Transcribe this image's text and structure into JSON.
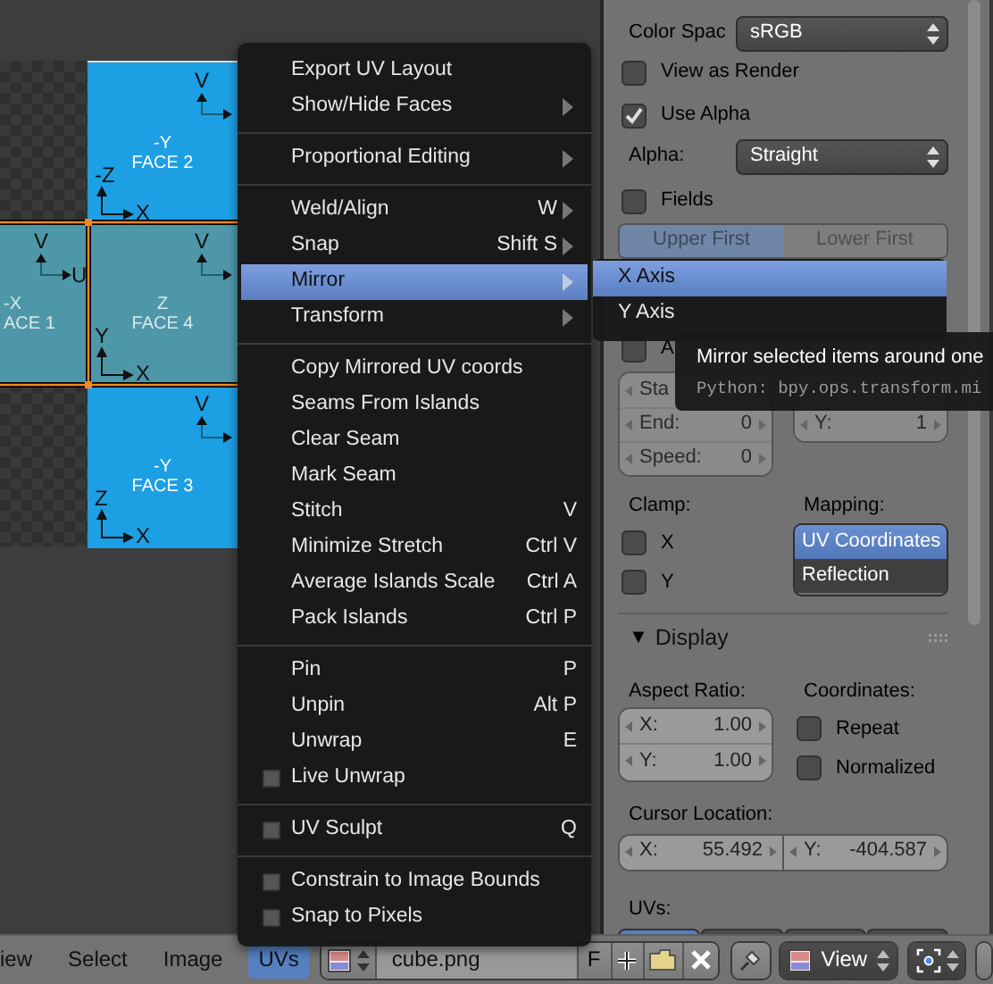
{
  "uv_editor": {
    "faces": [
      {
        "line1": "-Y",
        "line2": "FACE 2",
        "selected": false,
        "top_axis": [
          "V"
        ],
        "bottom_axis": [
          "-Z",
          "X"
        ]
      },
      {
        "line1": "-X",
        "line2": "ACE 1",
        "selected": true,
        "top_axis": [
          "V",
          "U"
        ]
      },
      {
        "line1": "Z",
        "line2": "FACE 4",
        "selected": true,
        "top_axis": [
          "V"
        ],
        "bottom_axis": [
          "Y",
          "X"
        ]
      },
      {
        "line1": "-Y",
        "line2": "FACE 3",
        "selected": false,
        "top_axis": [
          "V"
        ],
        "bottom_axis": [
          "Z",
          "X"
        ]
      }
    ]
  },
  "uvs_menu": {
    "items": [
      {
        "kind": "item",
        "label": "Export UV Layout",
        "submenu": false,
        "highlighted": false
      },
      {
        "kind": "item",
        "label": "Show/Hide Faces",
        "submenu": true,
        "highlighted": false
      },
      {
        "kind": "separator"
      },
      {
        "kind": "item",
        "label": "Proportional Editing",
        "submenu": true,
        "highlighted": false
      },
      {
        "kind": "separator"
      },
      {
        "kind": "item",
        "label": "Weld/Align",
        "shortcut": "W",
        "submenu": true,
        "highlighted": false
      },
      {
        "kind": "item",
        "label": "Snap",
        "shortcut": "Shift S",
        "submenu": true,
        "highlighted": false
      },
      {
        "kind": "item",
        "label": "Mirror",
        "submenu": true,
        "highlighted": true
      },
      {
        "kind": "item",
        "label": "Transform",
        "submenu": true,
        "highlighted": false
      },
      {
        "kind": "separator"
      },
      {
        "kind": "item",
        "label": "Copy Mirrored UV coords",
        "submenu": false,
        "highlighted": false
      },
      {
        "kind": "item",
        "label": "Seams From Islands",
        "submenu": false,
        "highlighted": false
      },
      {
        "kind": "item",
        "label": "Clear Seam",
        "submenu": false,
        "highlighted": false
      },
      {
        "kind": "item",
        "label": "Mark Seam",
        "submenu": false,
        "highlighted": false
      },
      {
        "kind": "item",
        "label": "Stitch",
        "shortcut": "V",
        "submenu": false,
        "highlighted": false
      },
      {
        "kind": "item",
        "label": "Minimize Stretch",
        "shortcut": "Ctrl V",
        "submenu": false,
        "highlighted": false
      },
      {
        "kind": "item",
        "label": "Average Islands Scale",
        "shortcut": "Ctrl A",
        "submenu": false,
        "highlighted": false
      },
      {
        "kind": "item",
        "label": "Pack Islands",
        "shortcut": "Ctrl P",
        "submenu": false,
        "highlighted": false
      },
      {
        "kind": "separator"
      },
      {
        "kind": "item",
        "label": "Pin",
        "shortcut": "P",
        "submenu": false,
        "highlighted": false
      },
      {
        "kind": "item",
        "label": "Unpin",
        "shortcut": "Alt P",
        "submenu": false,
        "highlighted": false
      },
      {
        "kind": "item",
        "label": "Unwrap",
        "shortcut": "E",
        "submenu": false,
        "highlighted": false
      },
      {
        "kind": "toggle",
        "label": "Live Unwrap",
        "checked": false,
        "highlighted": false
      },
      {
        "kind": "separator"
      },
      {
        "kind": "toggle",
        "label": "UV Sculpt",
        "shortcut": "Q",
        "checked": false,
        "highlighted": false
      },
      {
        "kind": "separator"
      },
      {
        "kind": "toggle",
        "label": "Constrain to Image Bounds",
        "checked": false,
        "highlighted": false
      },
      {
        "kind": "toggle",
        "label": "Snap to Pixels",
        "checked": false,
        "highlighted": false
      }
    ]
  },
  "mirror_submenu": {
    "items": [
      {
        "label": "X Axis",
        "highlighted": true
      },
      {
        "label": "Y Axis",
        "highlighted": false
      }
    ]
  },
  "tooltip": {
    "description": "Mirror selected items around one",
    "python": "Python: bpy.ops.transform.mi"
  },
  "properties": {
    "color_space": {
      "label": "Color Spac",
      "value": "sRGB"
    },
    "view_as_render": {
      "label": "View as Render",
      "checked": false
    },
    "use_alpha": {
      "label": "Use Alpha",
      "checked": true
    },
    "alpha": {
      "label": "Alpha:",
      "value": "Straight"
    },
    "fields": {
      "label": "Fields",
      "checked": false
    },
    "field_order": [
      {
        "label": "Upper First",
        "selected": true
      },
      {
        "label": "Lower First",
        "selected": false
      }
    ],
    "animated": {
      "label": "A",
      "checked": false
    },
    "frame_fields": [
      {
        "label": "Sta"
      },
      {
        "label": "End:",
        "value": "0"
      },
      {
        "label": "Speed:",
        "value": "0"
      }
    ],
    "tile_fields": [
      {
        "label": "Y:",
        "value": "1"
      }
    ],
    "clamp": {
      "label": "Clamp:",
      "options": [
        {
          "label": "X",
          "checked": false
        },
        {
          "label": "Y",
          "checked": false
        }
      ]
    },
    "mapping": {
      "label": "Mapping:",
      "options": [
        {
          "label": "UV Coordinates",
          "selected": true
        },
        {
          "label": "Reflection",
          "selected": false
        }
      ]
    },
    "display": {
      "toggle": "▼",
      "title": "Display",
      "aspect_label": "Aspect Ratio:",
      "aspect": [
        {
          "label": "X:",
          "value": "1.00"
        },
        {
          "label": "Y:",
          "value": "1.00"
        }
      ],
      "coords_label": "Coordinates:",
      "coords": [
        {
          "label": "Repeat",
          "checked": false
        },
        {
          "label": "Normalized",
          "checked": false
        }
      ],
      "cursor_label": "Cursor Location:",
      "cursor": [
        {
          "label": "X:",
          "value": "55.492"
        },
        {
          "label": "Y:",
          "value": "-404.587"
        }
      ],
      "uvs_label": "UVs:",
      "uv_tabs": [
        {
          "selected": true
        },
        {
          "selected": false
        },
        {
          "selected": false
        },
        {
          "selected": false
        }
      ]
    }
  },
  "header": {
    "menus": [
      {
        "label": "iew",
        "selected": false
      },
      {
        "label": "Select",
        "selected": false
      },
      {
        "label": "Image",
        "selected": false
      },
      {
        "label": "UVs",
        "selected": true
      }
    ],
    "image_name": "cube.png",
    "fake_user": "F",
    "view_mode": "View"
  }
}
